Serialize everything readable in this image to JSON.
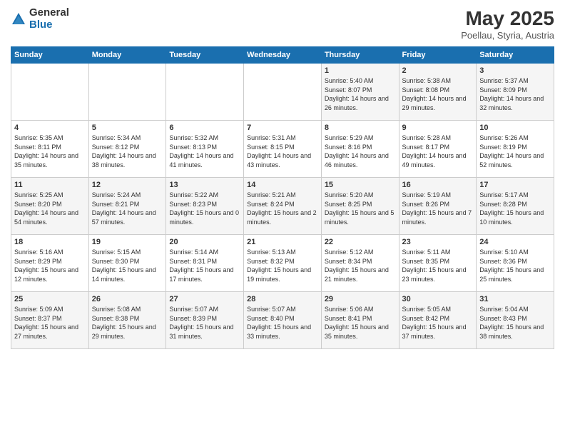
{
  "logo": {
    "general": "General",
    "blue": "Blue"
  },
  "title": "May 2025",
  "subtitle": "Poellau, Styria, Austria",
  "days_of_week": [
    "Sunday",
    "Monday",
    "Tuesday",
    "Wednesday",
    "Thursday",
    "Friday",
    "Saturday"
  ],
  "weeks": [
    [
      {
        "day": "",
        "info": ""
      },
      {
        "day": "",
        "info": ""
      },
      {
        "day": "",
        "info": ""
      },
      {
        "day": "",
        "info": ""
      },
      {
        "day": "1",
        "info": "Sunrise: 5:40 AM\nSunset: 8:07 PM\nDaylight: 14 hours\nand 26 minutes."
      },
      {
        "day": "2",
        "info": "Sunrise: 5:38 AM\nSunset: 8:08 PM\nDaylight: 14 hours\nand 29 minutes."
      },
      {
        "day": "3",
        "info": "Sunrise: 5:37 AM\nSunset: 8:09 PM\nDaylight: 14 hours\nand 32 minutes."
      }
    ],
    [
      {
        "day": "4",
        "info": "Sunrise: 5:35 AM\nSunset: 8:11 PM\nDaylight: 14 hours\nand 35 minutes."
      },
      {
        "day": "5",
        "info": "Sunrise: 5:34 AM\nSunset: 8:12 PM\nDaylight: 14 hours\nand 38 minutes."
      },
      {
        "day": "6",
        "info": "Sunrise: 5:32 AM\nSunset: 8:13 PM\nDaylight: 14 hours\nand 41 minutes."
      },
      {
        "day": "7",
        "info": "Sunrise: 5:31 AM\nSunset: 8:15 PM\nDaylight: 14 hours\nand 43 minutes."
      },
      {
        "day": "8",
        "info": "Sunrise: 5:29 AM\nSunset: 8:16 PM\nDaylight: 14 hours\nand 46 minutes."
      },
      {
        "day": "9",
        "info": "Sunrise: 5:28 AM\nSunset: 8:17 PM\nDaylight: 14 hours\nand 49 minutes."
      },
      {
        "day": "10",
        "info": "Sunrise: 5:26 AM\nSunset: 8:19 PM\nDaylight: 14 hours\nand 52 minutes."
      }
    ],
    [
      {
        "day": "11",
        "info": "Sunrise: 5:25 AM\nSunset: 8:20 PM\nDaylight: 14 hours\nand 54 minutes."
      },
      {
        "day": "12",
        "info": "Sunrise: 5:24 AM\nSunset: 8:21 PM\nDaylight: 14 hours\nand 57 minutes."
      },
      {
        "day": "13",
        "info": "Sunrise: 5:22 AM\nSunset: 8:23 PM\nDaylight: 15 hours\nand 0 minutes."
      },
      {
        "day": "14",
        "info": "Sunrise: 5:21 AM\nSunset: 8:24 PM\nDaylight: 15 hours\nand 2 minutes."
      },
      {
        "day": "15",
        "info": "Sunrise: 5:20 AM\nSunset: 8:25 PM\nDaylight: 15 hours\nand 5 minutes."
      },
      {
        "day": "16",
        "info": "Sunrise: 5:19 AM\nSunset: 8:26 PM\nDaylight: 15 hours\nand 7 minutes."
      },
      {
        "day": "17",
        "info": "Sunrise: 5:17 AM\nSunset: 8:28 PM\nDaylight: 15 hours\nand 10 minutes."
      }
    ],
    [
      {
        "day": "18",
        "info": "Sunrise: 5:16 AM\nSunset: 8:29 PM\nDaylight: 15 hours\nand 12 minutes."
      },
      {
        "day": "19",
        "info": "Sunrise: 5:15 AM\nSunset: 8:30 PM\nDaylight: 15 hours\nand 14 minutes."
      },
      {
        "day": "20",
        "info": "Sunrise: 5:14 AM\nSunset: 8:31 PM\nDaylight: 15 hours\nand 17 minutes."
      },
      {
        "day": "21",
        "info": "Sunrise: 5:13 AM\nSunset: 8:32 PM\nDaylight: 15 hours\nand 19 minutes."
      },
      {
        "day": "22",
        "info": "Sunrise: 5:12 AM\nSunset: 8:34 PM\nDaylight: 15 hours\nand 21 minutes."
      },
      {
        "day": "23",
        "info": "Sunrise: 5:11 AM\nSunset: 8:35 PM\nDaylight: 15 hours\nand 23 minutes."
      },
      {
        "day": "24",
        "info": "Sunrise: 5:10 AM\nSunset: 8:36 PM\nDaylight: 15 hours\nand 25 minutes."
      }
    ],
    [
      {
        "day": "25",
        "info": "Sunrise: 5:09 AM\nSunset: 8:37 PM\nDaylight: 15 hours\nand 27 minutes."
      },
      {
        "day": "26",
        "info": "Sunrise: 5:08 AM\nSunset: 8:38 PM\nDaylight: 15 hours\nand 29 minutes."
      },
      {
        "day": "27",
        "info": "Sunrise: 5:07 AM\nSunset: 8:39 PM\nDaylight: 15 hours\nand 31 minutes."
      },
      {
        "day": "28",
        "info": "Sunrise: 5:07 AM\nSunset: 8:40 PM\nDaylight: 15 hours\nand 33 minutes."
      },
      {
        "day": "29",
        "info": "Sunrise: 5:06 AM\nSunset: 8:41 PM\nDaylight: 15 hours\nand 35 minutes."
      },
      {
        "day": "30",
        "info": "Sunrise: 5:05 AM\nSunset: 8:42 PM\nDaylight: 15 hours\nand 37 minutes."
      },
      {
        "day": "31",
        "info": "Sunrise: 5:04 AM\nSunset: 8:43 PM\nDaylight: 15 hours\nand 38 minutes."
      }
    ]
  ]
}
